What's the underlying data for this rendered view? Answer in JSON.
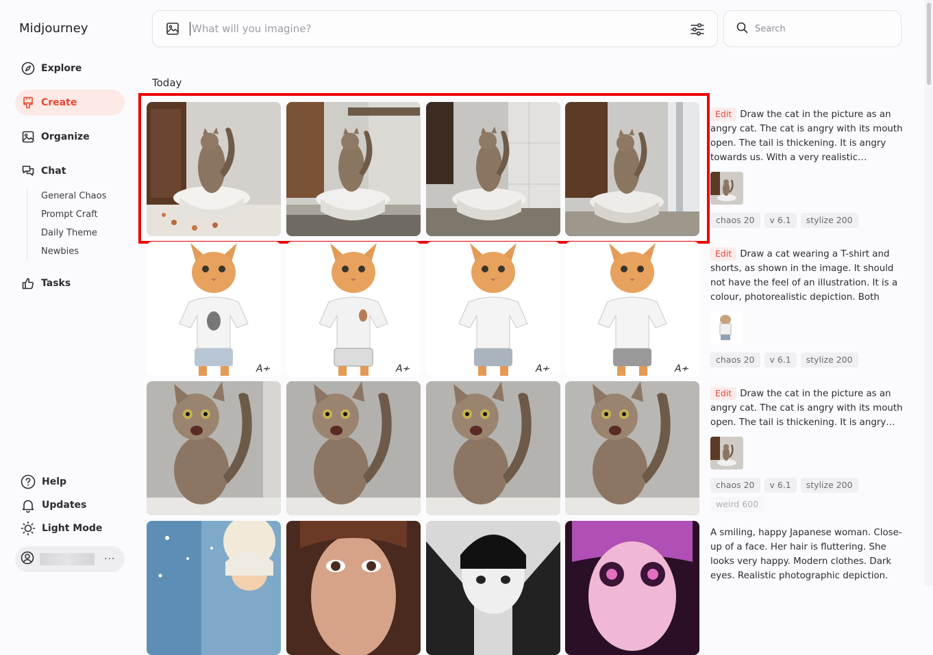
{
  "app": {
    "title": "Midjourney"
  },
  "nav": {
    "explore": "Explore",
    "create": "Create",
    "organize": "Organize",
    "chat": "Chat",
    "chat_rooms": [
      "General Chaos",
      "Prompt Craft",
      "Daily Theme",
      "Newbies"
    ],
    "tasks": "Tasks"
  },
  "bottom_nav": {
    "help": "Help",
    "updates": "Updates",
    "light_mode": "Light Mode",
    "more": "···"
  },
  "prompt_bar": {
    "placeholder": "What will you imagine?"
  },
  "search": {
    "placeholder": "Search"
  },
  "section": {
    "today": "Today"
  },
  "jobs": [
    {
      "edit_label": "Edit",
      "prompt": "Draw the cat in the picture as an angry cat. The cat is angry with its mouth open. The tail is thickening. It is angry towards us. With a very realistic…",
      "tags": [
        "chaos 20",
        "v 6.1",
        "stylize 200"
      ],
      "image_subject": "cat-on-toilet"
    },
    {
      "edit_label": "Edit",
      "prompt": "Draw a cat wearing a T-shirt and shorts, as shown in the image. It should not have the feel of an illustration. It is a colour, photorealistic depiction. Both the…",
      "tags": [
        "chaos 20",
        "v 6.1",
        "stylize 200"
      ],
      "image_subject": "cat-in-tshirt"
    },
    {
      "edit_label": "Edit",
      "prompt": "Draw the cat in the picture as an angry cat. The cat is angry with its mouth open. The tail is thickening. It is angry…",
      "tags": [
        "chaos 20",
        "v 6.1",
        "stylize 200",
        "weird 600"
      ],
      "image_subject": "angry-cat-closeup"
    },
    {
      "prompt": "A smiling, happy Japanese woman. Close-up of a face. Her hair is fluttering. She looks very happy. Modern clothes. Dark eyes. Realistic photographic depiction.",
      "image_subject": "japanese-woman"
    }
  ]
}
